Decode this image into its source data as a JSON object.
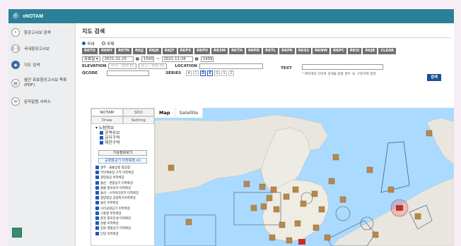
{
  "app": {
    "brand": "xNOTAM"
  },
  "sidebar": {
    "items": [
      {
        "label": "항공고시보 검색",
        "icon": "search-icon"
      },
      {
        "label": "국내항공고시보",
        "icon": "broadcast-icon"
      },
      {
        "label": "지도 검색",
        "icon": "globe-icon"
      },
      {
        "label": "월간 유효항공고시보 목록(PDF)",
        "icon": "document-icon"
      },
      {
        "label": "문자알림 서비스",
        "icon": "message-icon"
      }
    ]
  },
  "page": {
    "title": "지도 검색"
  },
  "form": {
    "scope_domestic": "국내",
    "scope_international": "국제",
    "fir_buttons": [
      "RKTO",
      "RKNY",
      "RKTN",
      "RKJJ",
      "RKJK",
      "RKJY",
      "RKPS",
      "RKPU",
      "RKSM",
      "RKTH",
      "RKPD",
      "RKTL",
      "RKPK",
      "RKSS",
      "RKNW",
      "RKPC",
      "RKSI",
      "RKJB",
      "CLEAR"
    ],
    "date_type": "유효일",
    "date_from": "2021-11-25",
    "time_from": "1500",
    "date_sep": "~",
    "date_to": "2021-11-26",
    "time_to": "1459",
    "elevation_label": "ELEVATION",
    "elevation_min_placeholder": "최저 : 000 FL",
    "elevation_max_placeholder": "최고 : 000 FL",
    "location_label": "LOCATION",
    "qcode_label": "QCODE",
    "series_label": "SERIES",
    "series": [
      "A",
      "C",
      "D",
      "E",
      "G",
      "S",
      "Z"
    ],
    "text_label": "TEXT",
    "text_hint": "* 여러개의 단어로 검색을 원할 경우 '&' 구분하여 입력",
    "search_button": "검색"
  },
  "panel": {
    "tabs": [
      "NOTAM",
      "SDO",
      "Draw",
      "Setting"
    ],
    "layer_group": "노탐정보",
    "layers": [
      "공역유보",
      "금지구역",
      "제한구역"
    ],
    "weather_button": "기상정보보기",
    "airport_button": "공항항공기 이착륙정 on",
    "airports": [
      "광주 · 울릉공항 항공청",
      "무안계류장 구역 이착륙장",
      "광양항공 이착륙장",
      "울산 · 경향공기 이착륙장",
      "울릉 항로표지 이착륙장",
      "울산 · 스마이더진하 이착륙장",
      "청양항공 공업박기이착륙장",
      "울진 이착륙장",
      "나리공원공기 이착륙장",
      "고흥항 이착륙장",
      "춘천 항로안내 이착륙장",
      "강릉 이착륙장",
      "진료 경항공기 이착륙장",
      "단양 이착륙장"
    ]
  },
  "map": {
    "tabs": [
      "Map",
      "Satellite"
    ]
  },
  "colors": {
    "topbar": "#2a8197",
    "fir_button": "#707074",
    "search_button": "#1f4e93",
    "sea": "#aadaff",
    "land": "#e8e6de"
  }
}
